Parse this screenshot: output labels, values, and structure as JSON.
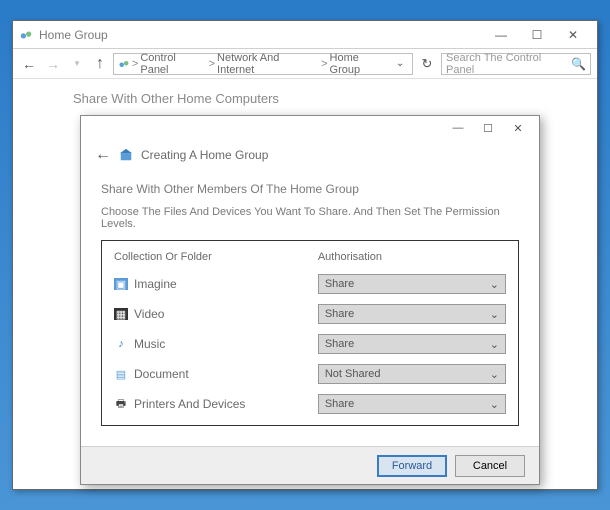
{
  "outerWindow": {
    "title": "Home Group",
    "breadcrumb": [
      "Control Panel",
      "Network And Internet",
      "Home Group"
    ],
    "searchPlaceholder": "Search The Control Panel",
    "pageHeading": "Share With Other Home Computers"
  },
  "wizard": {
    "title": "Creating A Home Group",
    "subtitle": "Share With Other Members Of The Home Group",
    "description": "Choose The Files And Devices You Want To Share. And Then Set The Permission Levels.",
    "colFolder": "Collection Or Folder",
    "colAuth": "Authorisation",
    "rows": [
      {
        "label": "Imagine",
        "auth": "Share",
        "iconClass": "icon-img"
      },
      {
        "label": "Video",
        "auth": "Share",
        "iconClass": "icon-video"
      },
      {
        "label": "Music",
        "auth": "Share",
        "iconClass": "icon-music"
      },
      {
        "label": "Document",
        "auth": "Not Shared",
        "iconClass": "icon-doc"
      },
      {
        "label": "Printers And Devices",
        "auth": "Share",
        "iconClass": "icon-print"
      }
    ],
    "forwardLabel": "Forward",
    "cancelLabel": "Cancel"
  }
}
